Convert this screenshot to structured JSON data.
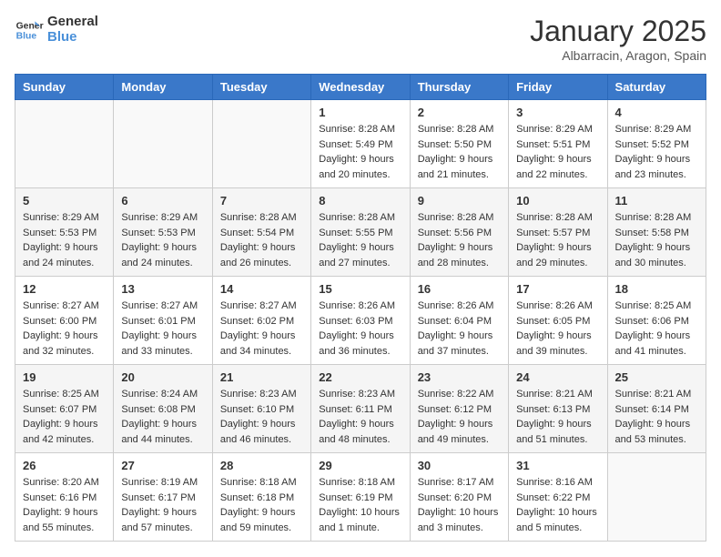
{
  "header": {
    "logo_line1": "General",
    "logo_line2": "Blue",
    "month": "January 2025",
    "location": "Albarracin, Aragon, Spain"
  },
  "days_of_week": [
    "Sunday",
    "Monday",
    "Tuesday",
    "Wednesday",
    "Thursday",
    "Friday",
    "Saturday"
  ],
  "weeks": [
    [
      {
        "day": "",
        "info": ""
      },
      {
        "day": "",
        "info": ""
      },
      {
        "day": "",
        "info": ""
      },
      {
        "day": "1",
        "info": "Sunrise: 8:28 AM\nSunset: 5:49 PM\nDaylight: 9 hours\nand 20 minutes."
      },
      {
        "day": "2",
        "info": "Sunrise: 8:28 AM\nSunset: 5:50 PM\nDaylight: 9 hours\nand 21 minutes."
      },
      {
        "day": "3",
        "info": "Sunrise: 8:29 AM\nSunset: 5:51 PM\nDaylight: 9 hours\nand 22 minutes."
      },
      {
        "day": "4",
        "info": "Sunrise: 8:29 AM\nSunset: 5:52 PM\nDaylight: 9 hours\nand 23 minutes."
      }
    ],
    [
      {
        "day": "5",
        "info": "Sunrise: 8:29 AM\nSunset: 5:53 PM\nDaylight: 9 hours\nand 24 minutes."
      },
      {
        "day": "6",
        "info": "Sunrise: 8:29 AM\nSunset: 5:53 PM\nDaylight: 9 hours\nand 24 minutes."
      },
      {
        "day": "7",
        "info": "Sunrise: 8:28 AM\nSunset: 5:54 PM\nDaylight: 9 hours\nand 26 minutes."
      },
      {
        "day": "8",
        "info": "Sunrise: 8:28 AM\nSunset: 5:55 PM\nDaylight: 9 hours\nand 27 minutes."
      },
      {
        "day": "9",
        "info": "Sunrise: 8:28 AM\nSunset: 5:56 PM\nDaylight: 9 hours\nand 28 minutes."
      },
      {
        "day": "10",
        "info": "Sunrise: 8:28 AM\nSunset: 5:57 PM\nDaylight: 9 hours\nand 29 minutes."
      },
      {
        "day": "11",
        "info": "Sunrise: 8:28 AM\nSunset: 5:58 PM\nDaylight: 9 hours\nand 30 minutes."
      }
    ],
    [
      {
        "day": "12",
        "info": "Sunrise: 8:27 AM\nSunset: 6:00 PM\nDaylight: 9 hours\nand 32 minutes."
      },
      {
        "day": "13",
        "info": "Sunrise: 8:27 AM\nSunset: 6:01 PM\nDaylight: 9 hours\nand 33 minutes."
      },
      {
        "day": "14",
        "info": "Sunrise: 8:27 AM\nSunset: 6:02 PM\nDaylight: 9 hours\nand 34 minutes."
      },
      {
        "day": "15",
        "info": "Sunrise: 8:26 AM\nSunset: 6:03 PM\nDaylight: 9 hours\nand 36 minutes."
      },
      {
        "day": "16",
        "info": "Sunrise: 8:26 AM\nSunset: 6:04 PM\nDaylight: 9 hours\nand 37 minutes."
      },
      {
        "day": "17",
        "info": "Sunrise: 8:26 AM\nSunset: 6:05 PM\nDaylight: 9 hours\nand 39 minutes."
      },
      {
        "day": "18",
        "info": "Sunrise: 8:25 AM\nSunset: 6:06 PM\nDaylight: 9 hours\nand 41 minutes."
      }
    ],
    [
      {
        "day": "19",
        "info": "Sunrise: 8:25 AM\nSunset: 6:07 PM\nDaylight: 9 hours\nand 42 minutes."
      },
      {
        "day": "20",
        "info": "Sunrise: 8:24 AM\nSunset: 6:08 PM\nDaylight: 9 hours\nand 44 minutes."
      },
      {
        "day": "21",
        "info": "Sunrise: 8:23 AM\nSunset: 6:10 PM\nDaylight: 9 hours\nand 46 minutes."
      },
      {
        "day": "22",
        "info": "Sunrise: 8:23 AM\nSunset: 6:11 PM\nDaylight: 9 hours\nand 48 minutes."
      },
      {
        "day": "23",
        "info": "Sunrise: 8:22 AM\nSunset: 6:12 PM\nDaylight: 9 hours\nand 49 minutes."
      },
      {
        "day": "24",
        "info": "Sunrise: 8:21 AM\nSunset: 6:13 PM\nDaylight: 9 hours\nand 51 minutes."
      },
      {
        "day": "25",
        "info": "Sunrise: 8:21 AM\nSunset: 6:14 PM\nDaylight: 9 hours\nand 53 minutes."
      }
    ],
    [
      {
        "day": "26",
        "info": "Sunrise: 8:20 AM\nSunset: 6:16 PM\nDaylight: 9 hours\nand 55 minutes."
      },
      {
        "day": "27",
        "info": "Sunrise: 8:19 AM\nSunset: 6:17 PM\nDaylight: 9 hours\nand 57 minutes."
      },
      {
        "day": "28",
        "info": "Sunrise: 8:18 AM\nSunset: 6:18 PM\nDaylight: 9 hours\nand 59 minutes."
      },
      {
        "day": "29",
        "info": "Sunrise: 8:18 AM\nSunset: 6:19 PM\nDaylight: 10 hours\nand 1 minute."
      },
      {
        "day": "30",
        "info": "Sunrise: 8:17 AM\nSunset: 6:20 PM\nDaylight: 10 hours\nand 3 minutes."
      },
      {
        "day": "31",
        "info": "Sunrise: 8:16 AM\nSunset: 6:22 PM\nDaylight: 10 hours\nand 5 minutes."
      },
      {
        "day": "",
        "info": ""
      }
    ]
  ]
}
